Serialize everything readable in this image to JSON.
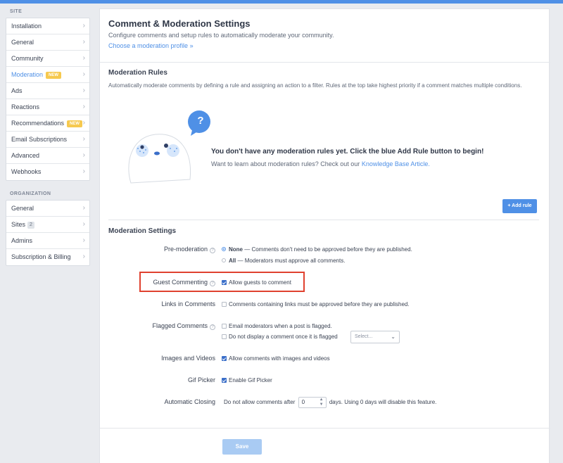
{
  "sidebar": {
    "site_heading": "SITE",
    "site_items": [
      {
        "label": "Installation"
      },
      {
        "label": "General"
      },
      {
        "label": "Community"
      },
      {
        "label": "Moderation",
        "badge": "NEW",
        "active": true
      },
      {
        "label": "Ads"
      },
      {
        "label": "Reactions"
      },
      {
        "label": "Recommendations",
        "badge": "NEW"
      },
      {
        "label": "Email Subscriptions"
      },
      {
        "label": "Advanced"
      },
      {
        "label": "Webhooks"
      }
    ],
    "org_heading": "ORGANIZATION",
    "org_items": [
      {
        "label": "General"
      },
      {
        "label": "Sites",
        "count": "2"
      },
      {
        "label": "Admins"
      },
      {
        "label": "Subscription & Billing"
      }
    ],
    "chevron": "›"
  },
  "header": {
    "title": "Comment & Moderation Settings",
    "description": "Configure comments and setup rules to automatically moderate your community.",
    "profile_link": "Choose a moderation profile »"
  },
  "rules": {
    "title": "Moderation Rules",
    "description": "Automatically moderate comments by defining a rule and assigning an action to a filter. Rules at the top take highest priority if a comment matches multiple conditions.",
    "empty_title": "You don't have any moderation rules yet. Click the blue Add Rule button to begin!",
    "empty_sub": "Want to learn about moderation rules? Check out our",
    "kb_link": "Knowledge Base Article.",
    "bubble_icon": "?",
    "add_button": "+ Add rule"
  },
  "settings": {
    "title": "Moderation Settings",
    "premod": {
      "label": "Pre-moderation",
      "none_bold": "None",
      "none_text": "— Comments don't need to be approved before they are published.",
      "all_bold": "All",
      "all_text": "— Moderators must approve all comments.",
      "selected": "None"
    },
    "guest": {
      "label": "Guest Commenting",
      "option": "Allow guests to comment",
      "checked": true
    },
    "links": {
      "label": "Links in Comments",
      "option": "Comments containing links must be approved before they are published.",
      "checked": false
    },
    "flagged": {
      "label": "Flagged Comments",
      "option1": "Email moderators when a post is flagged.",
      "option2": "Do not display a comment once it is flagged",
      "select_placeholder": "Select...",
      "checked1": false,
      "checked2": false
    },
    "images": {
      "label": "Images and Videos",
      "option": "Allow comments with images and videos",
      "checked": true
    },
    "gif": {
      "label": "Gif Picker",
      "option": "Enable Gif Picker",
      "checked": true
    },
    "closing": {
      "label": "Automatic Closing",
      "prefix": "Do not allow comments after",
      "value": "0",
      "suffix": "days. Using 0 days will disable this feature."
    },
    "help_icon": "?"
  },
  "save_label": "Save",
  "colors": {
    "accent": "#4f90e6",
    "highlight": "#e0412f",
    "new_badge": "#f6c94f"
  }
}
